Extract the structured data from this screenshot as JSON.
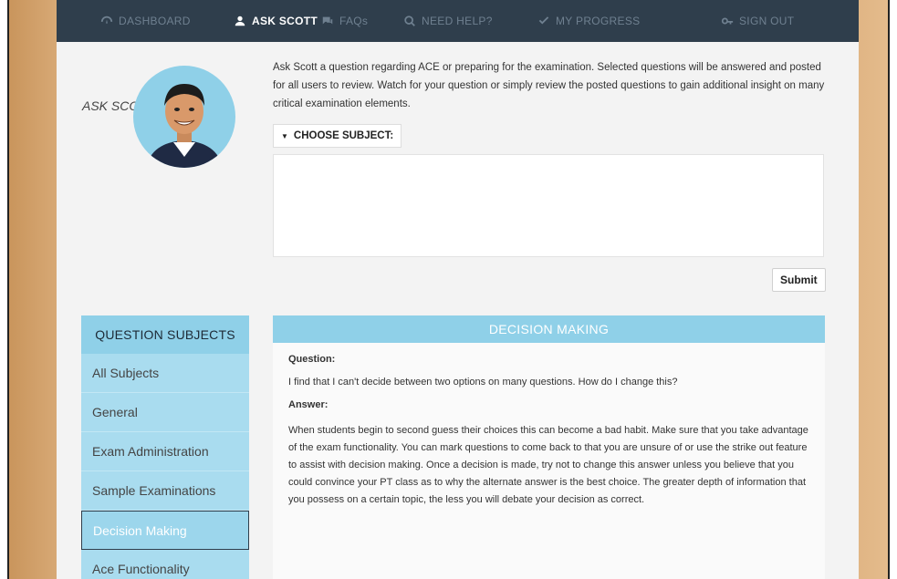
{
  "nav": {
    "items": [
      {
        "label": "DASHBOARD",
        "icon": "dashboard-icon",
        "active": false
      },
      {
        "label": "ASK SCOTT",
        "icon": "user-group-icon",
        "active": true
      },
      {
        "label": "FAQs",
        "icon": "chat-icon",
        "active": false
      },
      {
        "label": "NEED HELP?",
        "icon": "search-icon",
        "active": false
      },
      {
        "label": "MY PROGRESS",
        "icon": "check-icon",
        "active": false
      },
      {
        "label": "SIGN OUT",
        "icon": "key-icon",
        "active": false
      }
    ]
  },
  "ask": {
    "label": "ASK SCOTT!",
    "intro": "Ask Scott a question regarding ACE or preparing for the examination. Selected questions will be answered and posted for all users to review. Watch for your question or simply review the posted questions to gain additional insight on many critical examination elements.",
    "choose_subject": "CHOOSE SUBJECT:",
    "question_value": "",
    "submit_label": "Submit"
  },
  "sidebar": {
    "title": "QUESTION SUBJECTS",
    "items": [
      {
        "label": "All Subjects",
        "active": false
      },
      {
        "label": "General",
        "active": false
      },
      {
        "label": "Exam Administration",
        "active": false
      },
      {
        "label": "Sample Examinations",
        "active": false
      },
      {
        "label": "Decision Making",
        "active": true
      },
      {
        "label": "Ace Functionality",
        "active": false
      }
    ]
  },
  "content": {
    "title": "DECISION MAKING",
    "question_label": "Question:",
    "question_text": "I find that I can't decide between two options on many questions. How do I change this?",
    "answer_label": "Answer:",
    "answer_text": "When students begin to second guess their choices this can become a bad habit. Make sure that you take advantage of the exam functionality. You can mark questions to come back to that you are unsure of or use the strike out feature to assist with decision making. Once a decision is made, try not to change this answer unless you believe that you could convince your PT class as to why the alternate answer is the best choice. The greater depth of information that you possess on a certain topic, the less you will debate your decision as correct."
  },
  "colors": {
    "nav_bg": "#2f3e4c",
    "accent": "#8fd0e8",
    "sidebar_bg": "#a9dcef"
  }
}
